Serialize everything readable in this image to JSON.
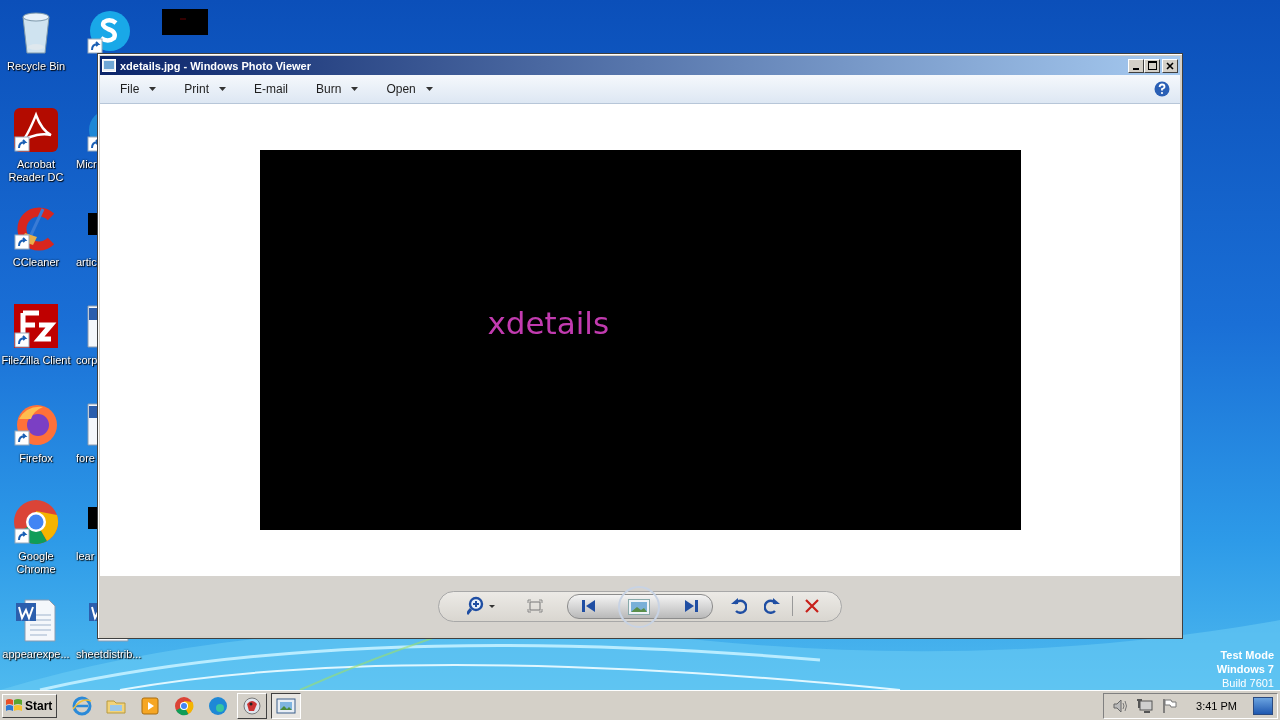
{
  "desktop": {
    "icons": [
      {
        "kind": "recycle",
        "label": "Recycle Bin"
      },
      {
        "kind": "acrobat",
        "label": "Acrobat Reader DC"
      },
      {
        "kind": "ccleaner",
        "label": "CCleaner"
      },
      {
        "kind": "filezilla",
        "label": "FileZilla Client"
      },
      {
        "kind": "firefox",
        "label": "Firefox"
      },
      {
        "kind": "chrome",
        "label": "Google Chrome"
      },
      {
        "kind": "word",
        "label": "appearexpe..."
      },
      {
        "kind": "skype"
      },
      {
        "kind": "edge",
        "label": "Micr"
      },
      {
        "kind": "blackfile",
        "label": "artic"
      },
      {
        "kind": "doc",
        "label": "corp"
      },
      {
        "kind": "doc",
        "label": "fore"
      },
      {
        "kind": "blackfile",
        "label": "lear"
      },
      {
        "kind": "word",
        "label": "sheetdistrib..."
      },
      {
        "kind": "blackthumb"
      }
    ]
  },
  "window": {
    "title": "xdetails.jpg - Windows Photo Viewer",
    "menu": [
      {
        "label": "File",
        "dropdown": true
      },
      {
        "label": "Print",
        "dropdown": true
      },
      {
        "label": "E-mail",
        "dropdown": false
      },
      {
        "label": "Burn",
        "dropdown": true
      },
      {
        "label": "Open",
        "dropdown": true
      }
    ],
    "image_text": "xdetails"
  },
  "desktop_notice": [
    "Test Mode",
    "Windows 7",
    "Build 7601"
  ],
  "taskbar": {
    "start": "Start",
    "apps": [
      {
        "kind": "ie",
        "running": false,
        "selected": false
      },
      {
        "kind": "explorer",
        "running": false,
        "selected": false
      },
      {
        "kind": "media",
        "running": false,
        "selected": false
      },
      {
        "kind": "chrome",
        "running": false,
        "selected": false
      },
      {
        "kind": "edge",
        "running": false,
        "selected": false
      },
      {
        "kind": "paint",
        "running": true,
        "selected": false
      },
      {
        "kind": "photoviewer",
        "running": true,
        "selected": true
      }
    ],
    "clock": "3:41 PM"
  }
}
